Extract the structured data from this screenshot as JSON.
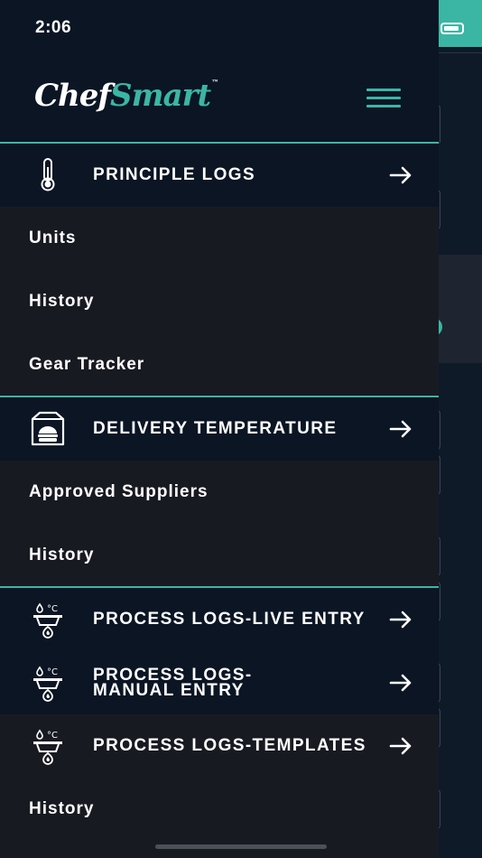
{
  "status_bar": {
    "time": "2:06"
  },
  "header": {
    "logo_part1": "Chef",
    "logo_part2": "Smart",
    "logo_tm": "™"
  },
  "menu": {
    "principle_logs": {
      "title": "PRINCIPLE LOGS",
      "icon": "thermometer-icon",
      "items": [
        {
          "label": "Units"
        },
        {
          "label": "History"
        },
        {
          "label": "Gear Tracker"
        }
      ]
    },
    "delivery_temperature": {
      "title": "DELIVERY TEMPERATURE",
      "icon": "delivery-bag-icon",
      "items": [
        {
          "label": "Approved Suppliers"
        },
        {
          "label": "History"
        }
      ]
    },
    "process_live": {
      "title": "PROCESS LOGS-LIVE ENTRY",
      "icon": "cooking-temperature-icon"
    },
    "process_manual": {
      "title_line1": "PROCESS LOGS-",
      "title_line2": "MANUAL ENTRY",
      "icon": "cooking-temperature-icon"
    },
    "process_templates": {
      "title": "PROCESS LOGS-TEMPLATES",
      "icon": "cooking-temperature-icon",
      "items": [
        {
          "label": "History"
        }
      ]
    }
  },
  "colors": {
    "accent": "#3bb6a4",
    "header_bg": "#0b1524",
    "item_bg": "#181a22"
  }
}
